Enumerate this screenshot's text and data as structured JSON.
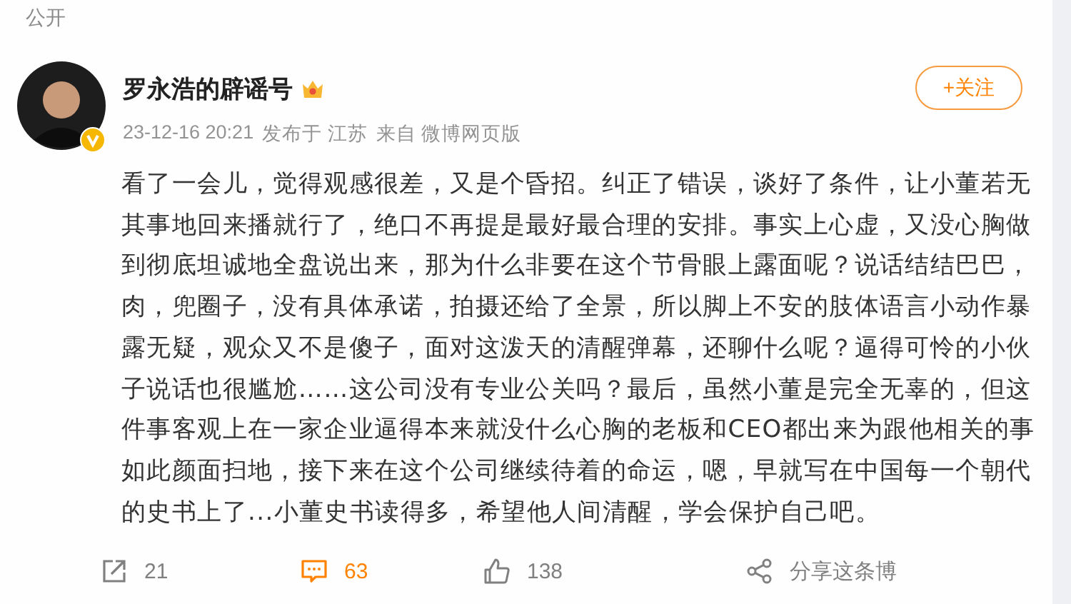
{
  "visibility_label": "公开",
  "author": {
    "name": "罗永浩的辟谣号",
    "verified": true
  },
  "meta": {
    "time": "23-12-16 20:21",
    "location": "发布于 江苏",
    "source": "来自 微博网页版"
  },
  "follow_button": {
    "label": "+关注"
  },
  "body": "看了一会儿，觉得观感很差，又是个昏招。纠正了错误，谈好了条件，让小董若无其事地回来播就行了，绝口不再提是最好最合理的安排。事实上心虚，又没心胸做到彻底坦诚地全盘说出来，那为什么非要在这个节骨眼上露面呢？说话结结巴巴，肉，兜圈子，没有具体承诺，拍摄还给了全景，所以脚上不安的肢体语言小动作暴露无疑，观众又不是傻子，面对这泼天的清醒弹幕，还聊什么呢？逼得可怜的小伙子说话也很尴尬……这公司没有专业公关吗？最后，虽然小董是完全无辜的，但这件事客观上在一家企业逼得本来就没什么心胸的老板和CEO都出来为跟他相关的事如此颜面扫地，接下来在这个公司继续待着的命运，嗯，早就写在中国每一个朝代的史书上了...小董史书读得多，希望他人间清醒，学会保护自己吧。",
  "actions": [
    {
      "kind": "repost",
      "label": "21",
      "color": "#808080"
    },
    {
      "kind": "comment",
      "label": "63",
      "color": "#ff8200"
    },
    {
      "kind": "like",
      "label": "138",
      "color": "#808080"
    },
    {
      "kind": "share",
      "label": "分享这条博",
      "color": "#808080"
    }
  ]
}
